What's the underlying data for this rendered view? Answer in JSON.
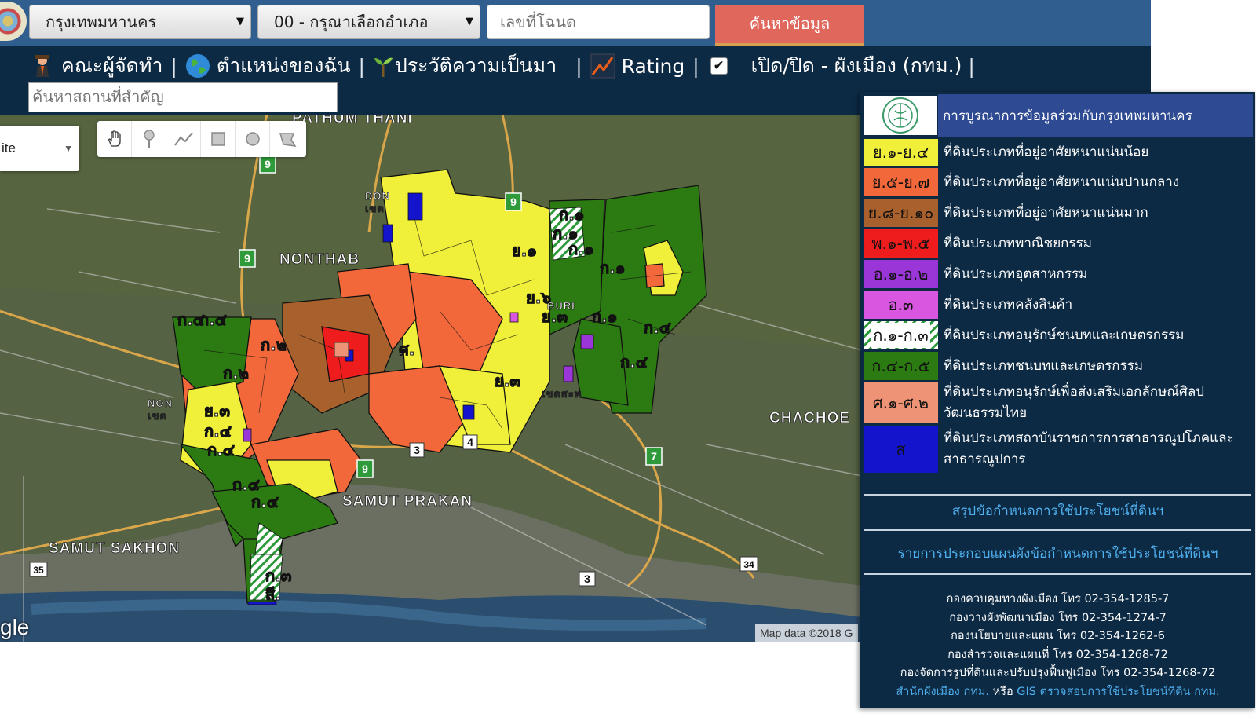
{
  "topbar": {
    "province_select": "กรุงเทพมหานคร",
    "district_select": "00 - กรุณาเลือกอำเภอ",
    "deed_placeholder": "เลขที่โฉนด",
    "search_button": "ค้นหาข้อมูล"
  },
  "nav": {
    "items": [
      "คณะผู้จัดทำ",
      "ตำแหน่งของฉัน",
      "ประวัติความเป็นมา",
      "Rating",
      "เปิด/ปิด - ผังเมือง (กทม.)"
    ],
    "toggle_checked": true
  },
  "place_search_placeholder": "ค้นหาสถานที่สำคัญ",
  "map": {
    "maptype_label": "ite",
    "google_mark": "gle",
    "attribution": "Map data ©2018 G",
    "place_labels": [
      "PATHUM THANI",
      "NONTHAB",
      "SAMUT PRAKAN",
      "SAMUT SAKHON",
      "CHACHOE",
      "NON",
      "เขต",
      "DON",
      "เขต",
      "BURI",
      "เขตสะพ"
    ],
    "route_shields": [
      "9",
      "9",
      "9",
      "9",
      "3",
      "4",
      "7",
      "35",
      "34",
      "3"
    ],
    "zone_labels": [
      "ก.๑",
      "ก.๑",
      "ก.๑",
      "ก.๑",
      "ก.๑",
      "ย.๑",
      "ย.๖",
      "ย.๓",
      "ย.๓",
      "ก.๔",
      "ก.๔",
      "ก.๔",
      "ก.๔",
      "ก.๔",
      "ก.๔",
      "ก.๔",
      "ก.๔",
      "ก.๒",
      "ก.๒",
      "ย.๓",
      "ศ.",
      "ก.๓",
      "สี."
    ]
  },
  "legend": {
    "header": "การบูรณาการข้อมูลร่วมกับกรุงเทพมหานคร",
    "rows": [
      {
        "code": "ย.๑-ย.๔",
        "desc": "ที่ดินประเภทที่อยู่อาศัยหนาแน่นน้อย",
        "color": "#f0f03a"
      },
      {
        "code": "ย.๕-ย.๗",
        "desc": "ที่ดินประเภทที่อยู่อาศัยหนาแน่นปานกลาง",
        "color": "#f2683a"
      },
      {
        "code": "ย.๘-ย.๑๐",
        "desc": "ที่ดินประเภทที่อยู่อาศัยหนาแน่นมาก",
        "color": "#a8602c"
      },
      {
        "code": "พ.๑-พ.๕",
        "desc": "ที่ดินประเภทพาณิชยกรรม",
        "color": "#ee1c1c"
      },
      {
        "code": "อ.๑-อ.๒",
        "desc": "ที่ดินประเภทอุตสาหกรรม",
        "color": "#9a35d8"
      },
      {
        "code": "อ.๓",
        "desc": "ที่ดินประเภทคลังสินค้า",
        "color": "#d957e0"
      },
      {
        "code": "ก.๑-ก.๓",
        "desc": "ที่ดินประเภทอนุรักษ์ชนบทและเกษตรกรรม",
        "color": "#ffffff"
      },
      {
        "code": "ก.๔-ก.๕",
        "desc": "ที่ดินประเภทชนบทและเกษตรกรรม",
        "color": "#2c7a12"
      },
      {
        "code": "ศ.๑-ศ.๒",
        "desc": "ที่ดินประเภทอนุรักษ์เพื่อส่งเสริมเอกลักษณ์ศิลปวัฒนธรรมไทย",
        "color": "#ee9375"
      },
      {
        "code": "ส",
        "desc": "ที่ดินประเภทสถาบันราชการการสาธารณูปโภคและสาธารณูปการ",
        "color": "#1414cc"
      }
    ],
    "link1": "สรุปข้อกำหนดการใช้ประโยชน์ที่ดินฯ",
    "link2": "รายการประกอบแผนผังข้อกำหนดการใช้ประโยชน์ที่ดินฯ",
    "contacts": [
      "กองควบคุมทางผังเมือง โทร 02-354-1285-7",
      "กองวางผังพัฒนาเมือง โทร 02-354-1274-7",
      "กองนโยบายและแผน โทร 02-354-1262-6",
      "กองสำรวจและแผนที่ โทร 02-354-1268-72",
      "กองจัดการรูปที่ดินและปรับปรุงฟื้นฟูเมือง โทร 02-354-1268-72"
    ],
    "footer_link1": "สำนักผังเมือง กทม.",
    "footer_or": "หรือ",
    "footer_link2": "GIS ตรวจสอบการใช้ประโยชน์ที่ดิน กทม."
  }
}
